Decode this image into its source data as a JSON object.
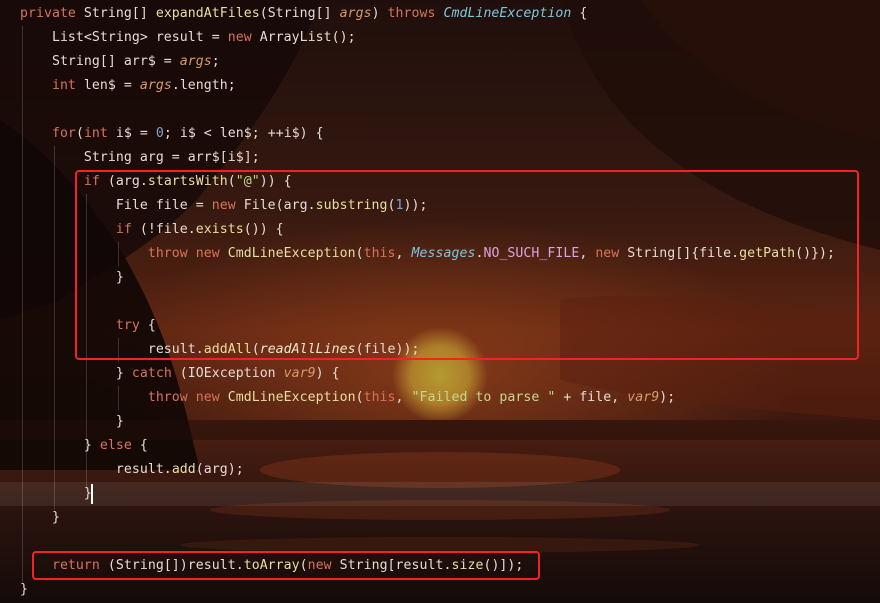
{
  "theme": {
    "keyword": "#d9735a",
    "function": "#e9dfa0",
    "parameter": "#d89b6a",
    "type_italic": "#7fc6dd",
    "string": "#c2d98d",
    "constant": "#dda3e0",
    "number": "#7fa4d4",
    "highlight_box": "#f02424",
    "background_image": "sunset-lake-wallpaper"
  },
  "code_lines": [
    [
      [
        "kw",
        "private "
      ],
      [
        "plain",
        "String[] "
      ],
      [
        "fn",
        "expandAtFiles"
      ],
      [
        "plain",
        "(String[] "
      ],
      [
        "param",
        "args"
      ],
      [
        "plain",
        ") "
      ],
      [
        "kw",
        "throws "
      ],
      [
        "typeit",
        "CmdLineException"
      ],
      [
        "plain",
        " {"
      ]
    ],
    [
      [
        "plain",
        "    List<String> result = "
      ],
      [
        "kw",
        "new "
      ],
      [
        "plain",
        "ArrayList();"
      ]
    ],
    [
      [
        "plain",
        "    String[] arr$ = "
      ],
      [
        "param",
        "args"
      ],
      [
        "plain",
        ";"
      ]
    ],
    [
      [
        "kw",
        "    int "
      ],
      [
        "plain",
        "len$ = "
      ],
      [
        "param",
        "args"
      ],
      [
        "plain",
        ".length;"
      ]
    ],
    [
      [
        "plain",
        ""
      ]
    ],
    [
      [
        "kw",
        "    for"
      ],
      [
        "plain",
        "("
      ],
      [
        "kw",
        "int "
      ],
      [
        "plain",
        "i$ = "
      ],
      [
        "num",
        "0"
      ],
      [
        "plain",
        "; i$ < len$; ++i$) {"
      ]
    ],
    [
      [
        "plain",
        "        String arg = arr$[i$];"
      ]
    ],
    [
      [
        "kw",
        "        if "
      ],
      [
        "plain",
        "(arg."
      ],
      [
        "fn",
        "startsWith"
      ],
      [
        "plain",
        "("
      ],
      [
        "str",
        "\"@\""
      ],
      [
        "plain",
        ")) {"
      ]
    ],
    [
      [
        "plain",
        "            File file = "
      ],
      [
        "kw",
        "new "
      ],
      [
        "plain",
        "File(arg."
      ],
      [
        "fn",
        "substring"
      ],
      [
        "plain",
        "("
      ],
      [
        "num",
        "1"
      ],
      [
        "plain",
        "));"
      ]
    ],
    [
      [
        "kw",
        "            if "
      ],
      [
        "plain",
        "(!file."
      ],
      [
        "fn",
        "exists"
      ],
      [
        "plain",
        "()) {"
      ]
    ],
    [
      [
        "kw",
        "                throw new "
      ],
      [
        "fn",
        "CmdLineException"
      ],
      [
        "plain",
        "("
      ],
      [
        "kw",
        "this"
      ],
      [
        "plain",
        ", "
      ],
      [
        "typeit",
        "Messages"
      ],
      [
        "plain",
        "."
      ],
      [
        "const",
        "NO_SUCH_FILE"
      ],
      [
        "plain",
        ", "
      ],
      [
        "kw",
        "new "
      ],
      [
        "plain",
        "String[]{file."
      ],
      [
        "fn",
        "getPath"
      ],
      [
        "plain",
        "()});"
      ]
    ],
    [
      [
        "plain",
        "            }"
      ]
    ],
    [
      [
        "plain",
        ""
      ]
    ],
    [
      [
        "kw",
        "            try "
      ],
      [
        "plain",
        "{"
      ]
    ],
    [
      [
        "plain",
        "                result."
      ],
      [
        "fn",
        "addAll"
      ],
      [
        "plain",
        "("
      ],
      [
        "static",
        "readAllLines"
      ],
      [
        "plain",
        "(file));"
      ]
    ],
    [
      [
        "plain",
        "            } "
      ],
      [
        "kw",
        "catch "
      ],
      [
        "plain",
        "(IOException "
      ],
      [
        "local",
        "var9"
      ],
      [
        "plain",
        ") {"
      ]
    ],
    [
      [
        "kw",
        "                throw new "
      ],
      [
        "fn",
        "CmdLineException"
      ],
      [
        "plain",
        "("
      ],
      [
        "kw",
        "this"
      ],
      [
        "plain",
        ", "
      ],
      [
        "str",
        "\"Failed to parse \""
      ],
      [
        "plain",
        " + file, "
      ],
      [
        "local",
        "var9"
      ],
      [
        "plain",
        ");"
      ]
    ],
    [
      [
        "plain",
        "            }"
      ]
    ],
    [
      [
        "plain",
        "        } "
      ],
      [
        "kw",
        "else "
      ],
      [
        "plain",
        "{"
      ]
    ],
    [
      [
        "plain",
        "            result."
      ],
      [
        "fn",
        "add"
      ],
      [
        "plain",
        "(arg);"
      ]
    ],
    [
      [
        "plain",
        "        }"
      ]
    ],
    [
      [
        "plain",
        "    }"
      ]
    ],
    [
      [
        "plain",
        ""
      ]
    ],
    [
      [
        "kw",
        "    return "
      ],
      [
        "plain",
        "(String[])result."
      ],
      [
        "fn",
        "toArray"
      ],
      [
        "plain",
        "("
      ],
      [
        "kw",
        "new "
      ],
      [
        "plain",
        "String[result."
      ],
      [
        "fn",
        "size"
      ],
      [
        "plain",
        "()]);"
      ]
    ],
    [
      [
        "plain",
        "}"
      ]
    ]
  ]
}
